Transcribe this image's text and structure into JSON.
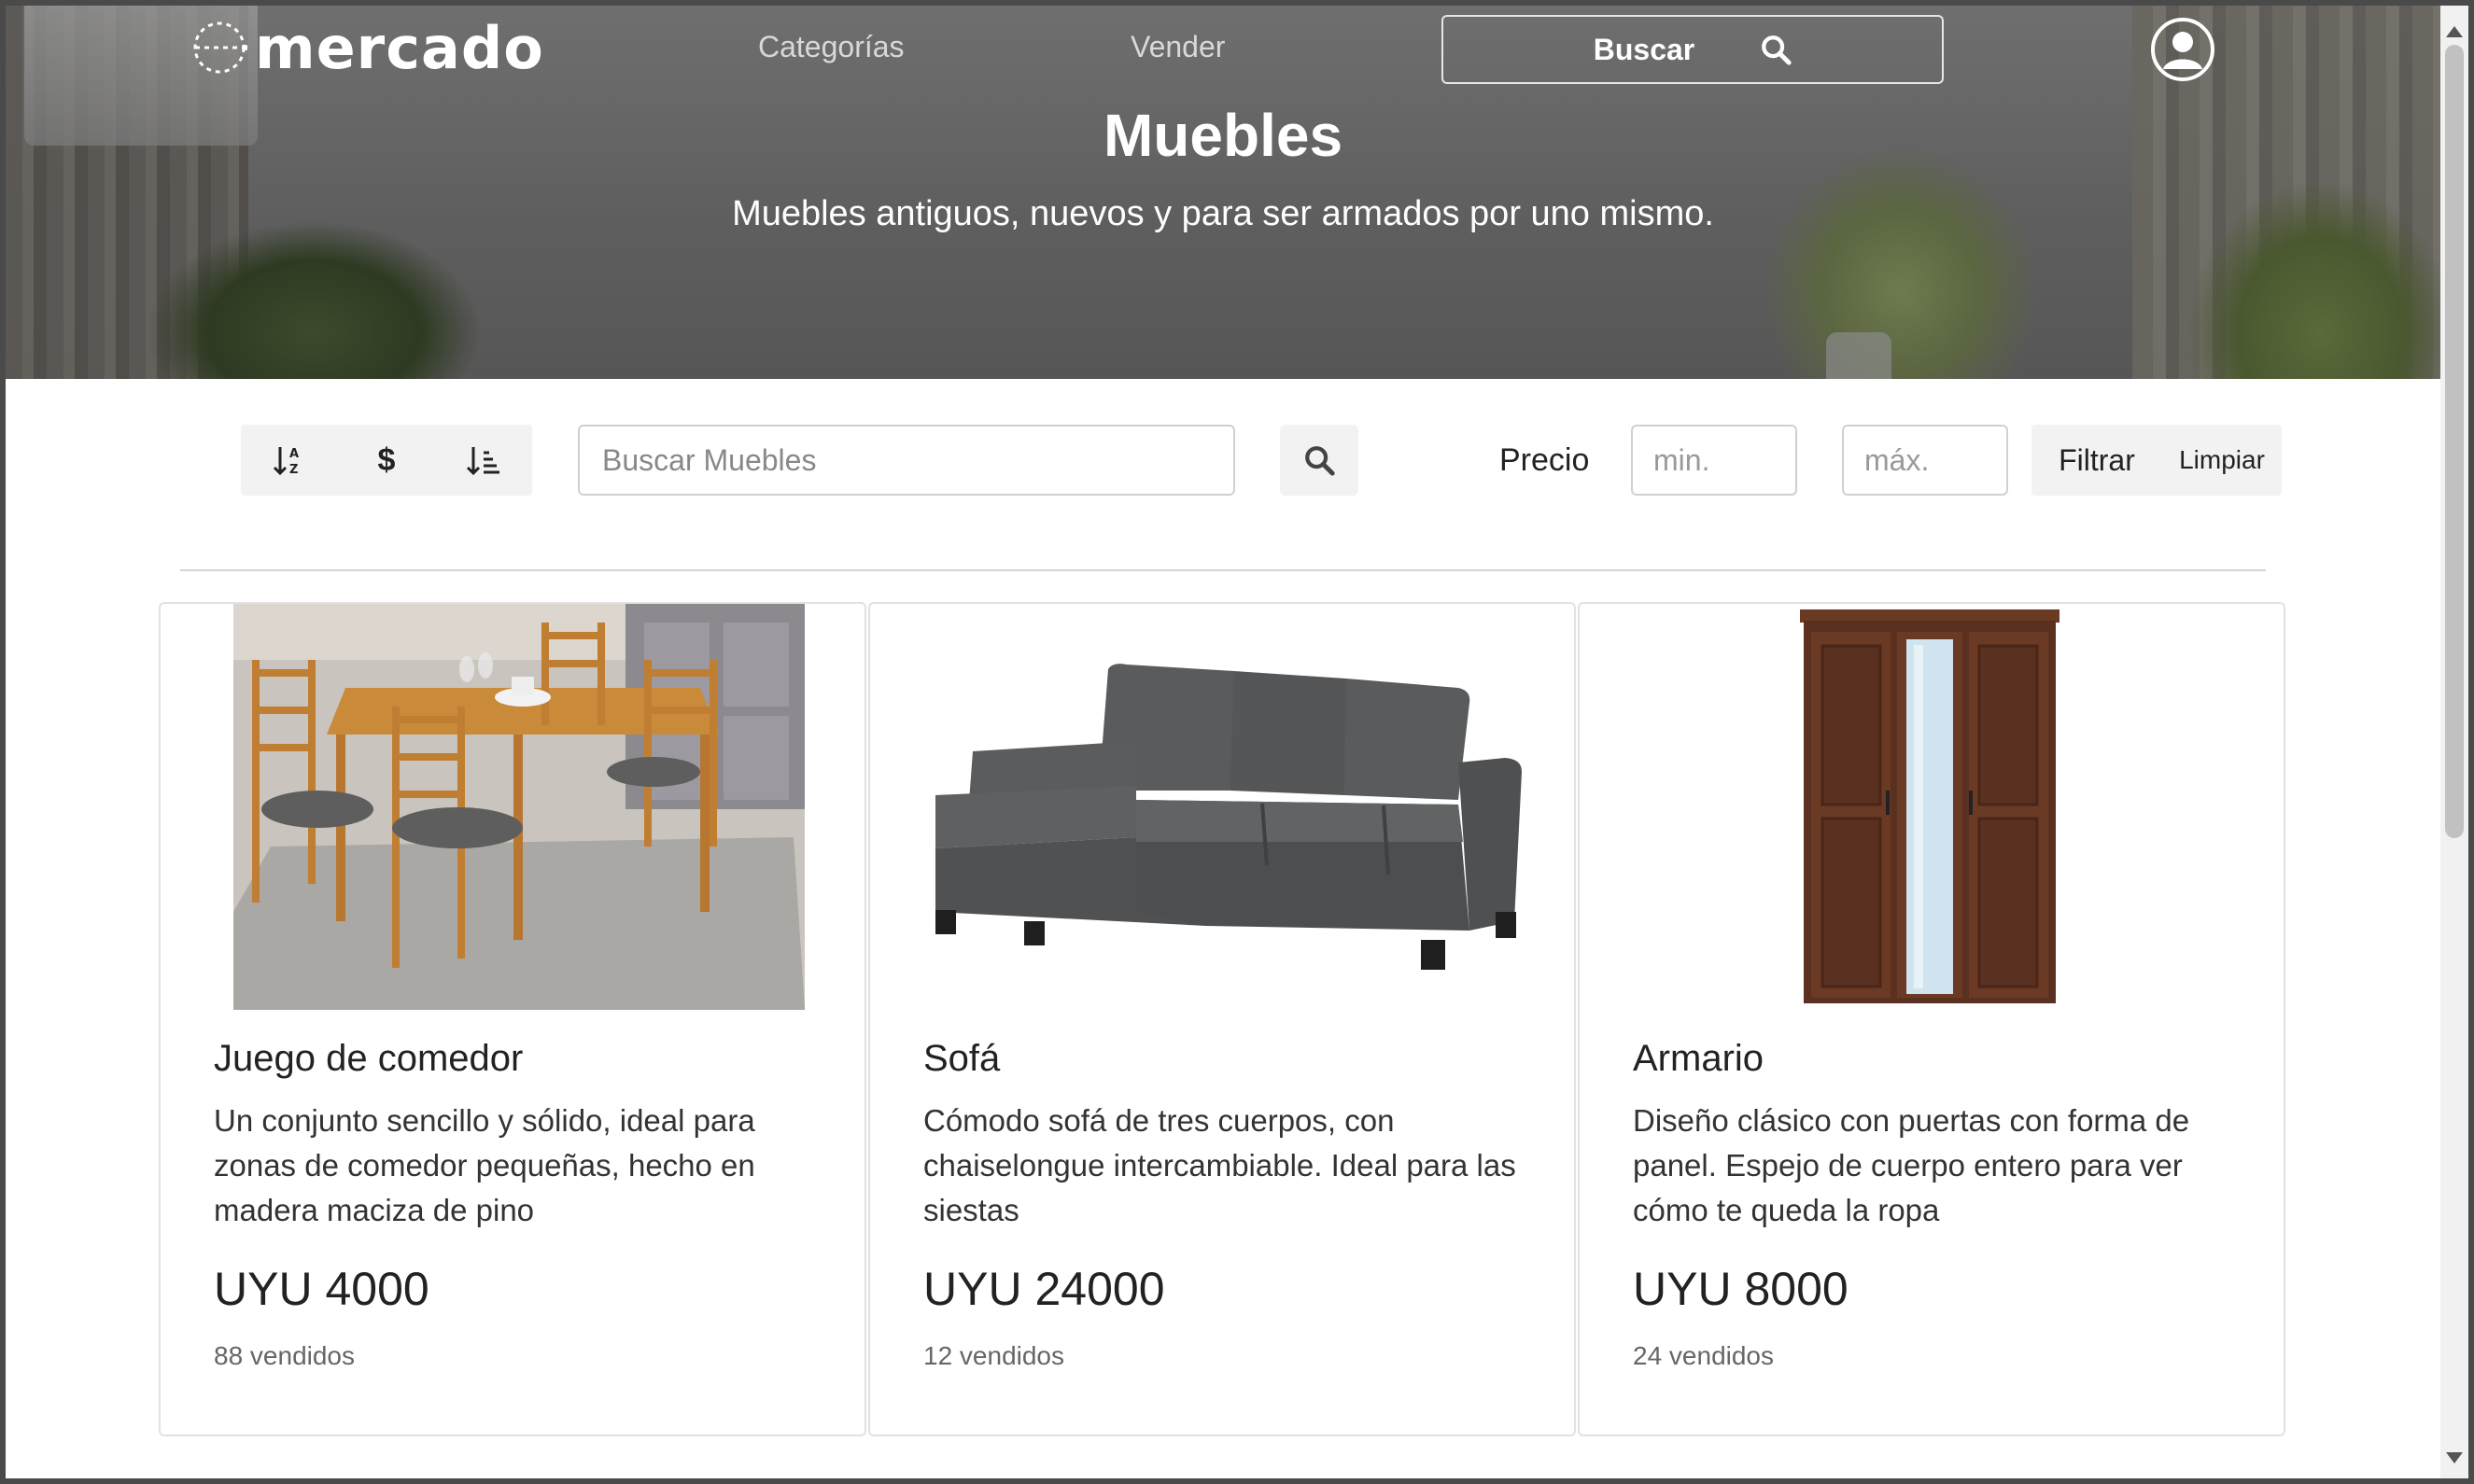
{
  "header": {
    "logo_text": "mercado",
    "nav": {
      "categories_label": "Categorías",
      "sell_label": "Vender"
    },
    "search_label": "Buscar"
  },
  "hero": {
    "title": "Muebles",
    "subtitle": "Muebles antiguos, nuevos y para ser armados por uno mismo."
  },
  "filters": {
    "sort_options": [
      {
        "icon": "sort-alpha-icon"
      },
      {
        "label": "$",
        "icon": "dollar-icon"
      },
      {
        "icon": "sort-amount-icon"
      }
    ],
    "search_placeholder": "Buscar Muebles",
    "price_label": "Precio",
    "min_placeholder": "min.",
    "max_placeholder": "máx.",
    "filter_button": "Filtrar",
    "clear_button": "Limpiar"
  },
  "products": [
    {
      "name": "Juego de comedor",
      "description": "Un conjunto sencillo y sólido, ideal para zonas de comedor pequeñas, hecho en madera maciza de pino",
      "price": "UYU 4000",
      "sold": "88 vendidos"
    },
    {
      "name": "Sofá",
      "description": "Cómodo sofá de tres cuerpos, con chaiselongue intercambiable. Ideal para las siestas",
      "price": "UYU 24000",
      "sold": "12 vendidos"
    },
    {
      "name": "Armario",
      "description": "Diseño clásico con puertas con forma de panel. Espejo de cuerpo entero para ver cómo te queda la ropa",
      "price": "UYU 8000",
      "sold": "24 vendidos"
    }
  ]
}
